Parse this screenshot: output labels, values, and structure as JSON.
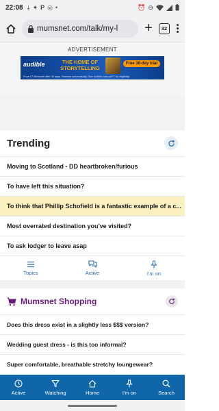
{
  "status_bar": {
    "time": "22:08",
    "icons": [
      "download-icon",
      "twitter-icon",
      "paypal-icon",
      "instagram-icon",
      "dot-icon"
    ],
    "right_icons": [
      "alarm-off-icon",
      "do-not-disturb-icon",
      "wifi-icon",
      "signal-icon",
      "battery-icon"
    ]
  },
  "browser": {
    "url": "mumsnet.com/talk/my-l",
    "tab_count": "32"
  },
  "ad": {
    "label": "ADVERTISEMENT",
    "brand": "audible",
    "headline": "THE HOME OF STORYTELLING",
    "cta": "Free 30-day trial",
    "fine_print": "From £7.99/month after 30 days. Renews automatically. See audible.com.uk/FT for eligibility."
  },
  "trending": {
    "title": "Trending",
    "items": [
      {
        "label": "Moving to Scotland - DD heartbroken/furious"
      },
      {
        "label": "To have left this situation?"
      },
      {
        "label": "To think that Phillip Schofield is a fantastic example of a c..."
      },
      {
        "label": "Most overrated destination you've visited?"
      },
      {
        "label": "To ask lodger to leave asap"
      }
    ],
    "tabs": [
      {
        "label": "Topics"
      },
      {
        "label": "Active"
      },
      {
        "label": "I'm on"
      }
    ]
  },
  "shopping": {
    "title": "Mumsnet Shopping",
    "items": [
      {
        "label": "Does this dress exist in a slightly less $$$ version?"
      },
      {
        "label": "Wedding guest dress - is this too informal?"
      },
      {
        "label": "Super comfortable, breathable stretchy loungewear?"
      }
    ]
  },
  "bottom_nav": {
    "items": [
      {
        "label": "Active"
      },
      {
        "label": "Watching"
      },
      {
        "label": "Home"
      },
      {
        "label": "I'm on"
      },
      {
        "label": "Search"
      }
    ]
  },
  "colors": {
    "accent_blue": "#0f66a8",
    "shopping_purple": "#6a1a7a",
    "highlight_yellow": "#fbf0bf"
  }
}
